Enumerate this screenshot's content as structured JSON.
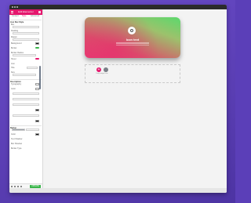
{
  "sidebar": {
    "header_title": "Edit Elementor",
    "tabs": [
      "Content",
      "Style",
      "Advanced"
    ],
    "rows": [
      {
        "label": "Icon Box Style"
      },
      {
        "label": "Box"
      },
      {
        "label": "Padding"
      },
      {
        "label": "Margin"
      },
      {
        "label": "Background"
      },
      {
        "label": "Border"
      },
      {
        "label": "Border Radius"
      },
      {
        "label": "Hover"
      },
      {
        "label": "Icon"
      },
      {
        "label": "Title"
      },
      {
        "label": "Size"
      },
      {
        "label": "Description"
      },
      {
        "label": "Typography"
      },
      {
        "label": "Color"
      },
      {
        "label": "Button"
      },
      {
        "label": "Normal"
      },
      {
        "label": "Hover"
      },
      {
        "label": "Color"
      },
      {
        "label": "Text Shadow"
      },
      {
        "label": "Box Shadow"
      },
      {
        "label": "Border Type"
      }
    ],
    "footer": {
      "update_label": "UPDATE"
    }
  },
  "canvas": {
    "card": {
      "title": "Icon text",
      "icon": "eye-icon"
    },
    "drop_zone": {
      "add_icon": "plus-icon",
      "template_icon": "folder-icon",
      "text": "Drag widget here"
    }
  },
  "colors": {
    "accent": "#e4176d",
    "update": "#39b54a",
    "background": "#5b3fb8",
    "card_gradient_start": "#e83a73",
    "card_gradient_end": "#5bd96d"
  }
}
